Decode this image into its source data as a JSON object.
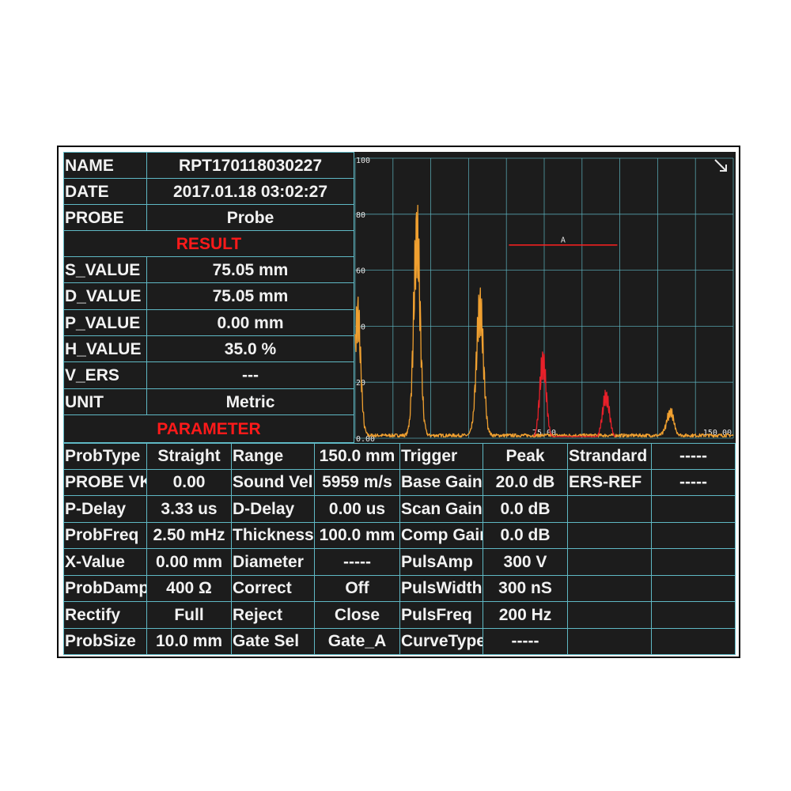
{
  "info": [
    {
      "label": "NAME",
      "value": "RPT170118030227"
    },
    {
      "label": "DATE",
      "value": "2017.01.18  03:02:27"
    },
    {
      "label": "PROBE",
      "value": "Probe"
    }
  ],
  "result_heading": "RESULT",
  "results": [
    {
      "label": "S_VALUE",
      "value": "75.05 mm"
    },
    {
      "label": "D_VALUE",
      "value": "75.05 mm"
    },
    {
      "label": "P_VALUE",
      "value": "0.00 mm"
    },
    {
      "label": "H_VALUE",
      "value": "35.0 %"
    },
    {
      "label": "V_ERS",
      "value": "---"
    },
    {
      "label": "UNIT",
      "value": "Metric"
    }
  ],
  "parameter_heading": "PARAMETER",
  "parameters": [
    [
      "ProbType",
      "Straight",
      "Range",
      "150.0 mm",
      "Trigger",
      "Peak",
      "Strandard",
      "-----"
    ],
    [
      "PROBE VK",
      "0.00",
      "Sound Vel",
      "5959 m/s",
      "Base Gain",
      "20.0 dB",
      "ERS-REF",
      "-----"
    ],
    [
      "P-Delay",
      "3.33 us",
      "D-Delay",
      "0.00 us",
      "Scan Gain",
      "0.0 dB",
      "",
      ""
    ],
    [
      "ProbFreq",
      "2.50 mHz",
      "Thickness",
      "100.0 mm",
      "Comp Gain",
      "0.0 dB",
      "",
      ""
    ],
    [
      "X-Value",
      "0.00 mm",
      "Diameter",
      "-----",
      "PulsAmp",
      "300 V",
      "",
      ""
    ],
    [
      "ProbDamp",
      "400 Ω",
      "Correct",
      "Off",
      "PulsWidth",
      "300 nS",
      "",
      ""
    ],
    [
      "Rectify",
      "Full",
      "Reject",
      "Close",
      "PulsFreq",
      "200 Hz",
      "",
      ""
    ],
    [
      "ProbSize",
      "10.0 mm",
      "Gate Sel",
      "Gate_A",
      "CurveType",
      "-----",
      "",
      ""
    ]
  ],
  "chart_data": {
    "type": "line",
    "y_ticks": [
      "100",
      "80",
      "60",
      "40",
      "20",
      "0.00"
    ],
    "x_ticks": [
      "75.00",
      "150.00"
    ],
    "xlim": [
      0,
      150
    ],
    "ylim": [
      0,
      100
    ],
    "grid": true,
    "gate": {
      "label": "A",
      "start": 61,
      "end": 104,
      "level": 69
    },
    "series": [
      {
        "color": "#f0a030",
        "peaks": [
          [
            1,
            52,
            1.2
          ],
          [
            24.5,
            86,
            1.3
          ],
          [
            49.5,
            55,
            1.4
          ],
          [
            125,
            10,
            1.4
          ]
        ]
      },
      {
        "color": "#e8202a",
        "peaks": [
          [
            74.5,
            33,
            1.3
          ],
          [
            99.5,
            18,
            1.4
          ]
        ]
      }
    ],
    "resize_icon": "resize-arrow-icon"
  },
  "colors": {
    "background": "#1c1c1c",
    "grid": "#5fb8c4",
    "text": "#f2f2f2",
    "accent": "#ff1a1a",
    "trace1": "#f0a030",
    "trace2": "#e8202a"
  }
}
